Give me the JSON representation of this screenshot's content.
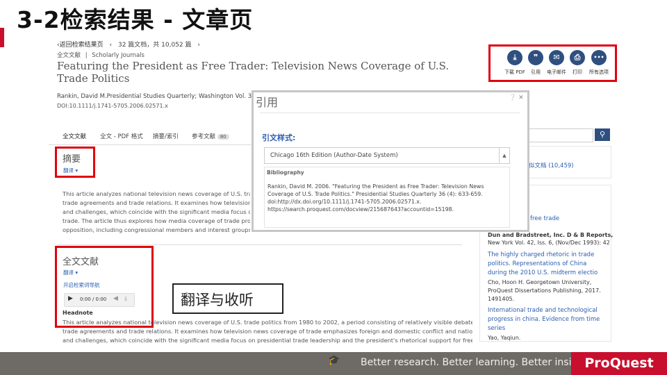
{
  "slide": {
    "title": "3-2检索结果 - 文章页"
  },
  "nav": {
    "back": "‹返回检索结果页",
    "prev": "‹",
    "position": "32 篇文档，共 10,052 篇",
    "next": "›"
  },
  "source": {
    "type": "全文文献",
    "sep": "|",
    "category": "Scholarly Journals"
  },
  "document": {
    "title": "Featuring the President as Free Trader: Television News Coverage of U.S. Trade Politics",
    "author_line": "Rankin, David M.Presidential Studies Quarterly; Washington  Vol. 36, Iss. 4",
    "doi": "DOI:10.1111/j.1741-5705.2006.02571.x"
  },
  "toolbar": [
    {
      "icon": "pdf-download-icon",
      "glyph": "⤓",
      "label": "下载 PDF"
    },
    {
      "icon": "quote-icon",
      "glyph": "❞",
      "label": "引用"
    },
    {
      "icon": "email-icon",
      "glyph": "✉",
      "label": "电子邮件"
    },
    {
      "icon": "print-icon",
      "glyph": "⎙",
      "label": "打印"
    },
    {
      "icon": "more-icon",
      "glyph": "•••",
      "label": "所有选项"
    }
  ],
  "tabs": [
    {
      "label": "全文文献"
    },
    {
      "label": "全文 - PDF 格式"
    },
    {
      "label": "摘要/索引"
    },
    {
      "label": "参考文献",
      "count": "80"
    }
  ],
  "abstract": {
    "heading": "摘要",
    "translate": "翻译 ▾",
    "lines": [
      "This article analyzes national television news coverage of U.S. trade polit",
      "trade agreements and trade relations. It examines how television news co",
      "and challenges, which coincide with the significant media focus on presid",
      "trade. The article thus explores how media coverage of trade provides th",
      "opposition, including congressional members and interest groups, when h"
    ]
  },
  "fulltext": {
    "heading": "全文文献",
    "translate": "翻译 ▾",
    "listen": "开启检索词导航",
    "audio_time": "0:00 / 0:00",
    "headnote": "Headnote",
    "lines": [
      "This article analyzes national television news coverage of U.S. trade politics from 1980 to 2002, a period consisting of relatively visible debates over free",
      "trade agreements and trade relations. It examines how television news coverage of trade emphasizes foreign and domestic conflict and national threats",
      "and challenges, which coincide with the significant media focus on presidential trade leadership and the president's rhetorical support for free and freer"
    ]
  },
  "callout": {
    "text": "翻译与收听"
  },
  "sidebar": {
    "search_icon": "search-icon",
    "related_count_text": "似文档 (10,459)",
    "item0": "free trade",
    "item1": {
      "source": "Dun and Bradstreet, Inc. D & B Reports,",
      "meta": "New York Vol. 42, Iss. 6, (Nov/Dec 1993): 42"
    },
    "item2": {
      "title": "The highly charged rhetoric in trade politics. Representations of China during the 2010 U.S. midterm electio",
      "meta": "Cho, Hoon H. Georgetown University, ProQuest Dissertations Publishing, 2017. 1491405."
    },
    "item3": {
      "title": "International trade and technological progress in china. Evidence from time series",
      "meta": "Yao, Yaqiun."
    }
  },
  "cite_popup": {
    "title": "引用",
    "icons": "❔ ✕",
    "style_label": "引文样式:",
    "style_value": "Chicago 16th Edition (Author-Date System)",
    "bib_heading": "Bibliography",
    "bib_text": "Rankin, David M. 2006. \"Featuring the President as Free Trader: Television News Coverage of U.S. Trade Politics.\" Presidential Studies Quarterly 36 (4): 633-659. doi:http://dx.doi.org/10.1111/j.1741-5705.2006.02571.x. https://search.proquest.com/docview/215687643?accountid=15198."
  },
  "footer": {
    "tagline": "Better research. Better learning. Better insights.",
    "logo": "ProQuest"
  },
  "colors": {
    "highlight": "#e0000f",
    "brand": "#c8102e",
    "footer_bg": "#6e6a66",
    "button_blue": "#2f4f80"
  }
}
